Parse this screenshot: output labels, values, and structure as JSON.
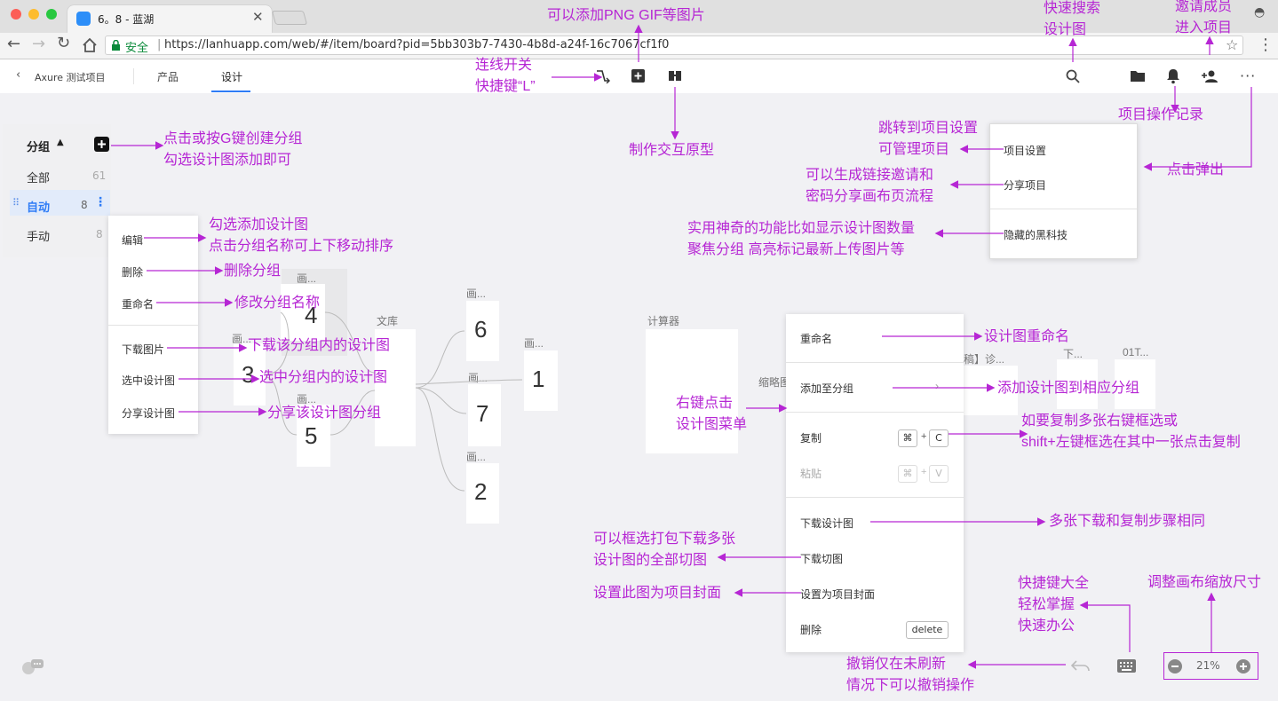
{
  "browser": {
    "tab_title": "6。8 - 蓝湖",
    "secure_label": "安全",
    "url": "https://lanhuapp.com/web/#/item/board?pid=5bb303b7-7430-4b8d-a24f-16c7067cf1f0"
  },
  "header": {
    "back_label": "Axure 测试项目",
    "tabs": [
      "产品",
      "设计"
    ],
    "active_tab": "设计"
  },
  "sidebar": {
    "group_label": "分组",
    "items": [
      {
        "label": "全部",
        "count": "61"
      },
      {
        "label": "自动",
        "count": "8"
      },
      {
        "label": "手动",
        "count": "8"
      }
    ]
  },
  "group_menu": {
    "items": [
      "编辑",
      "删除",
      "重命名",
      "下载图片",
      "选中设计图",
      "分享设计图"
    ]
  },
  "project_menu": {
    "items": [
      "项目设置",
      "分享项目",
      "隐藏的黑科技"
    ]
  },
  "context_menu": {
    "items": [
      "重命名",
      "添加至分组",
      "复制",
      "粘贴",
      "下载设计图",
      "下载切图",
      "设置为项目封面",
      "删除"
    ],
    "copy_keys": [
      "⌘",
      "C"
    ],
    "paste_keys": [
      "⌘",
      "V"
    ],
    "delete_key": "delete"
  },
  "canvas": {
    "cards": [
      {
        "num": "4",
        "title": "画..."
      },
      {
        "num": "3",
        "title": "画..."
      },
      {
        "num": "5",
        "title": "画..."
      },
      {
        "num": "6",
        "title": "画..."
      },
      {
        "num": "7",
        "title": "画..."
      },
      {
        "num": "2",
        "title": "画..."
      },
      {
        "num": "1",
        "title": "画..."
      }
    ],
    "library_title": "文库",
    "calc_title": "计算器",
    "thumb_title": "缩略图",
    "partial_titles": [
      "稿】诊...",
      "下...",
      "01T..."
    ]
  },
  "zoom": {
    "value": "21%"
  },
  "annotations": {
    "png": "可以添加PNG GIF等图片",
    "search": "快速搜索\n设计图",
    "invite": "邀请成员\n进入项目",
    "connect": "连线开关\n快捷键“L”",
    "group_create": "点击或按G键创建分组\n勾选设计图添加即可",
    "prototype": "制作交互原型",
    "project_settings": "跳转到项目设置\n可管理项目",
    "history": "项目操作记录",
    "popup_click": "点击弹出",
    "share_project": "可以生成链接邀请和\n密码分享画布页流程",
    "black_tech": "实用神奇的功能比如显示设计图数量\n聚焦分组 高亮标记最新上传图片等",
    "edit": "勾选添加设计图\n点击分组名称可上下移动排序",
    "delete_group": "删除分组",
    "rename_group": "修改分组名称",
    "download_group": "下载该分组内的设计图",
    "select_group": "选中分组内的设计图",
    "share_group": "分享该设计图分组",
    "rename_design": "设计图重命名",
    "add_to_group": "添加设计图到相应分组",
    "copy_multi": "如要复制多张右键框选或\nshift+左键框选在其中一张点击复制",
    "right_click": "右键点击\n设计图菜单",
    "download_multi": "多张下载和复制步骤相同",
    "download_slices": "可以框选打包下载多张\n设计图的全部切图",
    "set_cover": "设置此图为项目封面",
    "shortcuts": "快捷键大全\n轻松掌握\n快速办公",
    "zoom_adjust": "调整画布缩放尺寸",
    "undo": "撤销仅在未刷新\n情况下可以撤销操作"
  },
  "colors": {
    "annotation": "#b626d4",
    "accent": "#2f7cf6"
  }
}
